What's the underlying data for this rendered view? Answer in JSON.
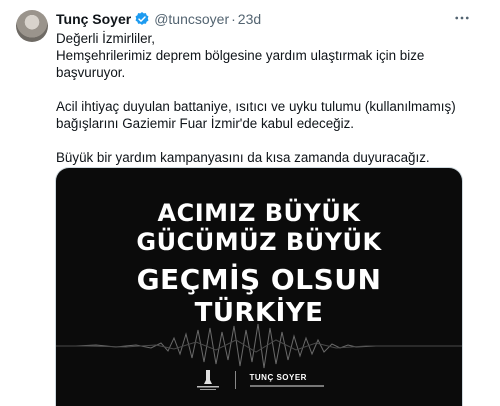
{
  "tweet": {
    "author_name": "Tunç Soyer",
    "handle": "@tuncsoyer",
    "separator": "·",
    "time": "23d",
    "more_icon": "ellipsis-icon",
    "verified_color": "#1d9bf0",
    "lines": [
      "Değerli İzmirliler,",
      "Hemşehrilerimiz deprem bölgesine yardım ulaştırmak için bize",
      "başvuruyor.",
      "Acil ihtiyaç duyulan battaniye, ısıtıcı ve uyku tulumu (kullanılmamış)",
      "bağışlarını Gaziemir Fuar İzmir'de kabul edeceğiz.",
      "Büyük bir yardım kampanyasını da kısa zamanda duyuracağız."
    ]
  },
  "media": {
    "line1": "ACIMIZ BÜYÜK",
    "line2": "GÜCÜMÜZ BÜYÜK",
    "line3": "GEÇMİŞ OLSUN",
    "line4": "TÜRKİYE",
    "logo_right": "TUNÇ SOYER",
    "background": "#0b0b0b"
  }
}
